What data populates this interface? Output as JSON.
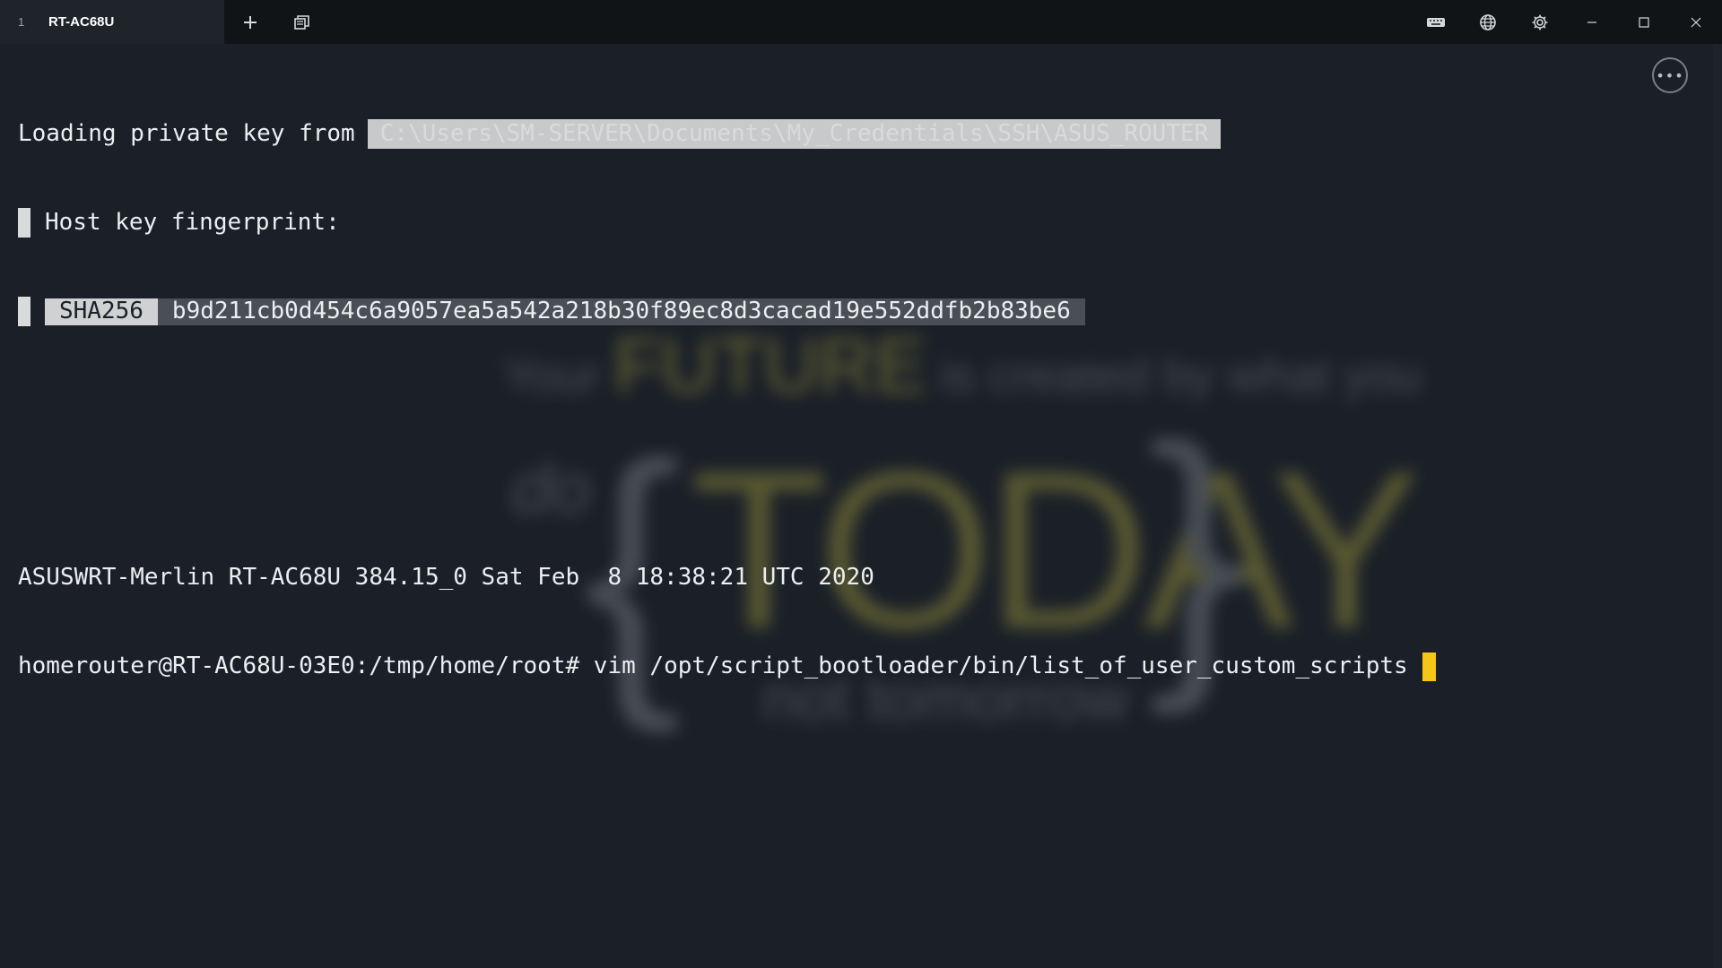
{
  "titlebar": {
    "tab_index": "1",
    "tab_title": "RT-AC68U",
    "new_tab_icon": "plus-icon",
    "duplicate_tab_icon": "duplicate-window-icon",
    "right_icons": [
      "keyboard-icon",
      "globe-icon",
      "gear-icon"
    ],
    "window_controls": [
      "minimize-icon",
      "maximize-icon",
      "close-icon"
    ]
  },
  "terminal": {
    "line1_prefix": "Loading private key from",
    "line1_path": "C:\\Users\\SM-SERVER\\Documents\\My_Credentials\\SSH\\ASUS_ROUTER",
    "line2": "Host key fingerprint:",
    "sha_label": "SHA256",
    "sha_value": "b9d211cb0d454c6a9057ea5a542a218b30f89ec8d3cacad19e552ddfb2b83be6",
    "banner": "ASUSWRT-Merlin RT-AC68U 384.15_0 Sat Feb  8 18:38:21 UTC 2020",
    "prompt": "homerouter@RT-AC68U-03E0:/tmp/home/root#",
    "command": "vim /opt/script_bootloader/bin/list_of_user_custom_scripts",
    "menu_button_label": "•••"
  },
  "wallpaper": {
    "line1_a": "Your",
    "line1_b": "FUTURE",
    "line1_c": "is created by what you",
    "do": "do",
    "brace_l": "{",
    "today": "TODAY",
    "brace_r": "}",
    "line3": "not tomorrow"
  },
  "colors": {
    "background": "#1b2028",
    "titlebar": "#111417",
    "cursor": "#f5c518",
    "text": "#eceef0"
  }
}
